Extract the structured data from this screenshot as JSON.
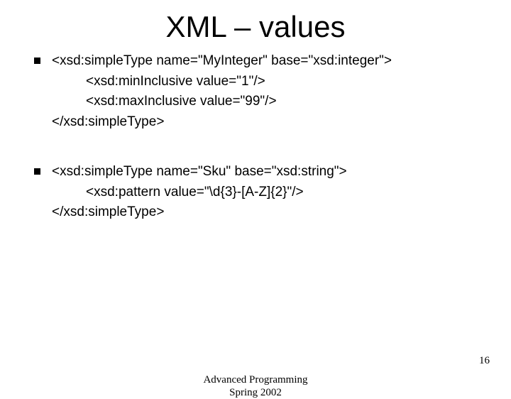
{
  "title": "XML – values",
  "block1": {
    "line1": "<xsd:simpleType name=\"MyInteger\" base=\"xsd:integer\">",
    "line2": "<xsd:minInclusive value=\"1\"/>",
    "line3": "<xsd:maxInclusive value=\"99\"/>",
    "line4": "</xsd:simpleType>"
  },
  "block2": {
    "line1": "<xsd:simpleType name=\"Sku\" base=\"xsd:string\">",
    "line2": "<xsd:pattern value=\"\\d{3}-[A-Z]{2}\"/>",
    "line3": "</xsd:simpleType>"
  },
  "footer": {
    "course": "Advanced Programming",
    "term": "Spring 2002",
    "page": "16"
  }
}
